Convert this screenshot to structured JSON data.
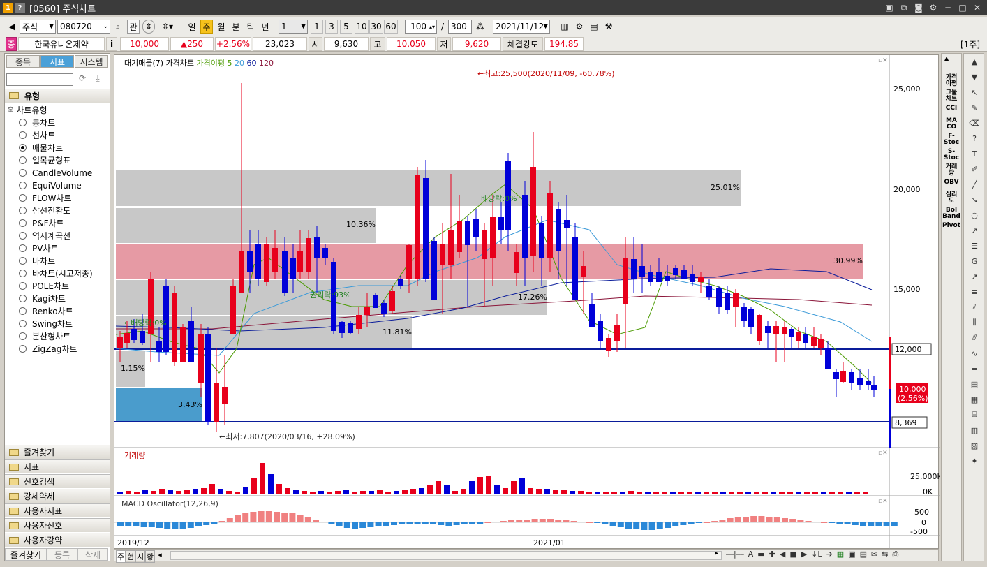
{
  "window": {
    "title": "[0560] 주식차트",
    "icon1": "1",
    "icon2": "?"
  },
  "toolbar": {
    "market": "주식",
    "code": "080720",
    "btn_gwan": "관",
    "periods": [
      "일",
      "주",
      "월",
      "분",
      "틱",
      "년"
    ],
    "active_period": "주",
    "interval": "1",
    "quick": [
      "1",
      "3",
      "5",
      "10",
      "30",
      "60"
    ],
    "count": "100",
    "slash": "/",
    "total": "300",
    "date": "2021/11/12"
  },
  "quote": {
    "badge": "증",
    "name": "한국유니온제약",
    "info": "i",
    "price": "10,000",
    "change": "▲250",
    "rate": "+2.56%",
    "volume": "23,023",
    "open_label": "시",
    "open": "9,630",
    "high_label": "고",
    "high": "10,050",
    "low_label": "저",
    "low": "9,620",
    "strength_label": "체결강도",
    "strength": "194.85",
    "period_tag": "[1주]"
  },
  "left_panel": {
    "tabs": [
      "종목",
      "지표",
      "시스템"
    ],
    "active_tab": "지표",
    "section": "유형",
    "tree_root": "차트유형",
    "items": [
      "봉차트",
      "선차트",
      "매물차트",
      "일목균형표",
      "CandleVolume",
      "EquiVolume",
      "FLOW차트",
      "삼선전환도",
      "P&F차트",
      "역시계곡선",
      "PV차트",
      "바차트",
      "바차트(시고저종)",
      "POLE차트",
      "Kagi차트",
      "Renko차트",
      "Swing차트",
      "분산형차트",
      "ZigZag차트"
    ],
    "selected": "매물차트",
    "folders": [
      "즐겨찾기",
      "지표",
      "신호검색",
      "강세약세",
      "사용자지표",
      "사용자신호",
      "사용자강약"
    ],
    "bottom_buttons": [
      "즐겨찾기",
      "등록",
      "삭제"
    ]
  },
  "chart": {
    "legend": {
      "t1": "대기매물(7)",
      "t2": "가격차트",
      "t3": "가격이평 5",
      "t4": "20",
      "t5": "60",
      "t6": "120"
    },
    "annotations": {
      "high": "←최고:25,500(2020/11/09, -60.78%)",
      "low": "←최저:7,807(2020/03/16, +28.09%)",
      "div1": "←배당락:0%",
      "rights": "권리락:93%",
      "div2": "배당락:0%"
    },
    "bands": [
      "25.01%",
      "10.36%",
      "30.99%",
      "17.26%",
      "11.81%",
      "1.15%",
      "3.43%"
    ],
    "yticks": [
      "25,000",
      "20,000",
      "15,000"
    ],
    "markers": {
      "m1": "12,000",
      "m2": "10,000",
      "m3": "(2.56%)",
      "m4": "8,369"
    },
    "volume_title": "거래량",
    "volume_ticks": [
      "25,000K",
      "0K"
    ],
    "macd_title": "MACD Oscillator(12,26,9)",
    "macd_ticks": [
      "500",
      "0",
      "-500"
    ],
    "x_labels": [
      "2019/12",
      "2021/01"
    ],
    "bottom_tabs": [
      "주",
      "현",
      "시",
      "황"
    ]
  },
  "right_panel": {
    "items": [
      "가격\n이평",
      "그물\n차트",
      "CCI",
      "MA\nCO",
      "F-\nStoc",
      "S-\nStoc",
      "거래\n량",
      "OBV",
      "심리\n도",
      "Bol\nBand",
      "Pivot"
    ]
  },
  "colors": {
    "up": "#e8001c",
    "down": "#0000d8",
    "ma5": "#4a9a00",
    "ma20": "#3b9ad8",
    "ma60": "#0a1c9a",
    "ma120": "#8a1438",
    "band_gray": "#c8c8c8",
    "band_red": "#e69aa4",
    "band_blue": "#4a9ccc"
  }
}
